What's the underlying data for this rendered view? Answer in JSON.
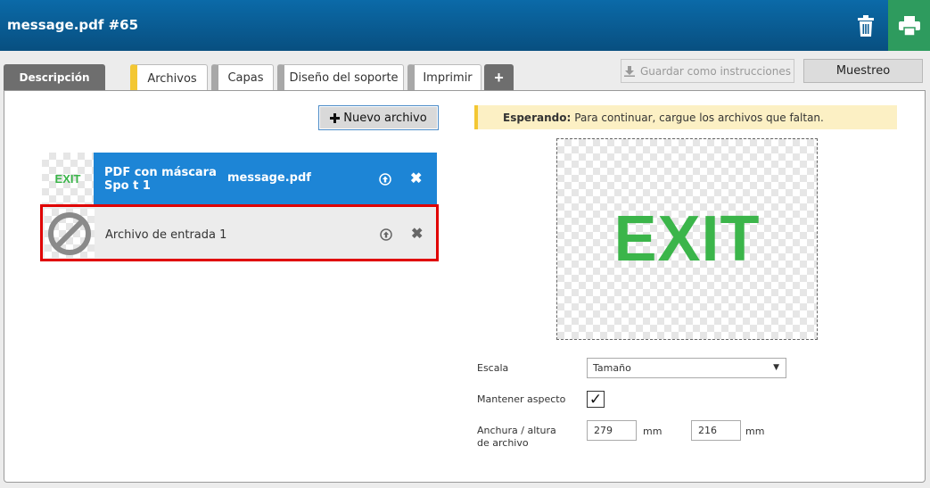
{
  "header": {
    "title": "message.pdf #65"
  },
  "tabs": [
    {
      "label": "Descripción"
    },
    {
      "label": "Archivos"
    },
    {
      "label": "Capas"
    },
    {
      "label": "Diseño del soporte"
    },
    {
      "label": "Imprimir"
    },
    {
      "label": "+"
    }
  ],
  "toolbar": {
    "save_label": "Guardar como instrucciones",
    "sample_label": "Muestreo"
  },
  "files": {
    "new_file_label": "Nuevo archivo",
    "rows": [
      {
        "thumb_text": "EXIT",
        "name": "PDF con máscara Spo t 1",
        "filename": "message.pdf"
      },
      {
        "name": "Archivo de entrada 1"
      }
    ]
  },
  "status": {
    "label": "Esperando:",
    "message": "Para continuar, cargue los archivos que faltan."
  },
  "preview": {
    "text": "EXIT"
  },
  "settings": {
    "scale_label": "Escala",
    "scale_value": "Tamaño",
    "keep_aspect_label": "Mantener aspecto",
    "keep_aspect_checked": true,
    "size_label": "Anchura / altura de archivo",
    "width_value": "279",
    "height_value": "216",
    "unit": "mm"
  },
  "colors": {
    "header": "#0b6aa8",
    "selected_row": "#1d85d6",
    "accent": "#f3c733",
    "error": "#e00000",
    "exit_green": "#3bb54a",
    "print": "#2e9b5e"
  },
  "icons": [
    "trash-icon",
    "print-icon",
    "plus-icon",
    "download-icon",
    "upload-icon",
    "close-icon",
    "prohibited-icon",
    "check-icon",
    "caret-down-icon"
  ]
}
